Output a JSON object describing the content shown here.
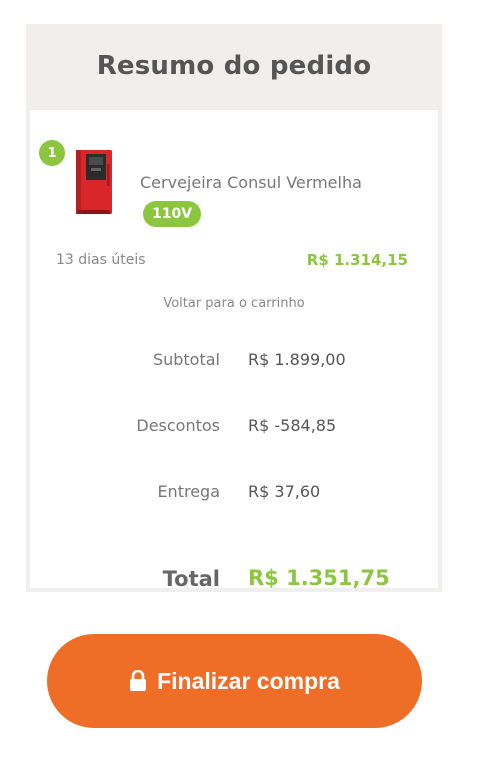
{
  "summary": {
    "title": "Resumo do pedido"
  },
  "item": {
    "quantity": "1",
    "name": "Cervejeira Consul Vermelha",
    "voltage": "110V",
    "delivery_time": "13 dias úteis",
    "price": "R$ 1.314,15",
    "image_icon": "red-beverage-cooler-image"
  },
  "totals": {
    "back_link": "Voltar para o carrinho",
    "subtotal_label": "Subtotal",
    "subtotal_value": "R$ 1.899,00",
    "discount_label": "Descontos",
    "discount_value": "R$ -584,85",
    "shipping_label": "Entrega",
    "shipping_value": "R$ 37,60",
    "total_label": "Total",
    "total_value": "R$ 1.351,75"
  },
  "checkout": {
    "label": "Finalizar compra",
    "icon": "lock-icon"
  },
  "colors": {
    "accent_green": "#8cc63f",
    "button_orange": "#ee6e27",
    "panel_gray": "#f0efee",
    "product_red": "#d9262b"
  }
}
